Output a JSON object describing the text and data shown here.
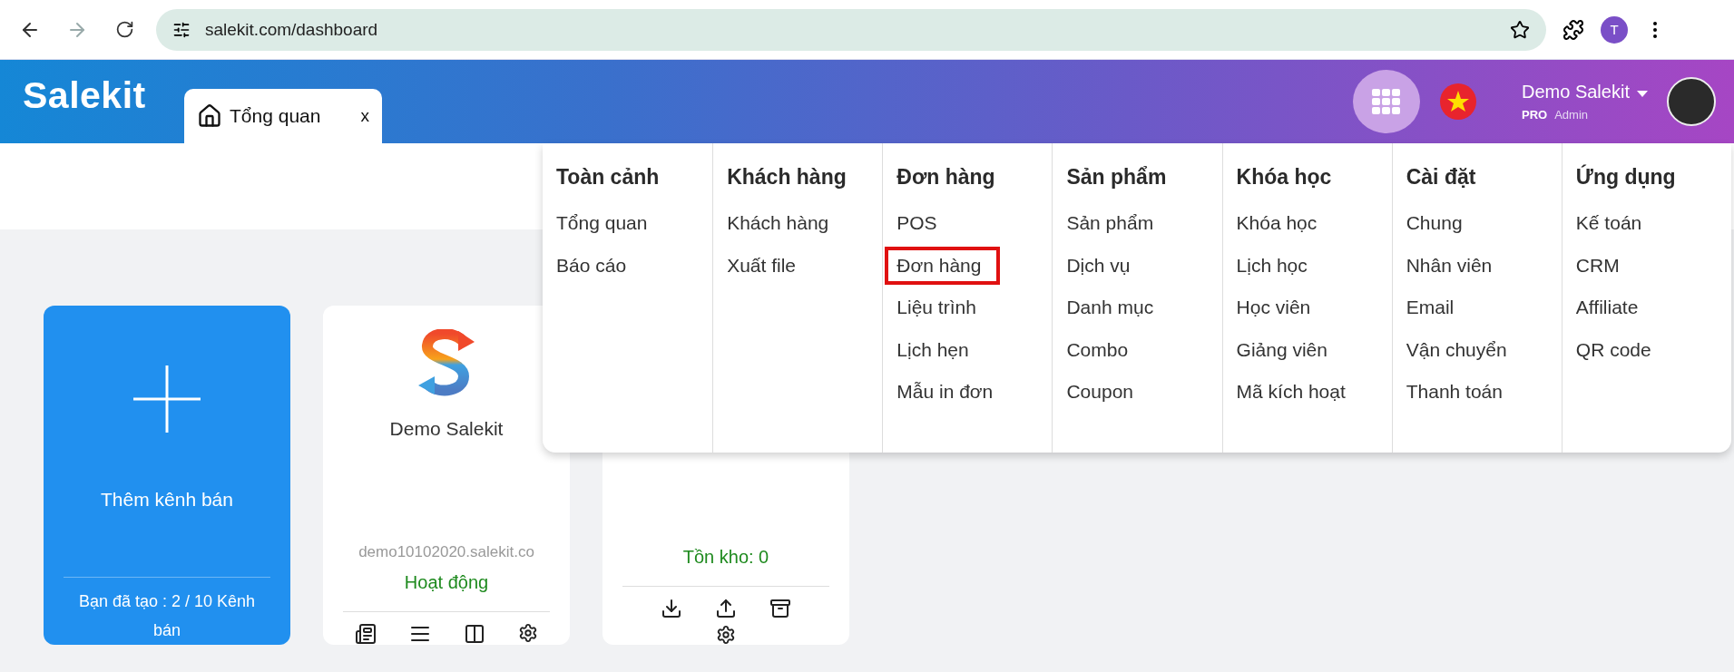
{
  "browser": {
    "url": "salekit.com/dashboard",
    "profile_initial": "T"
  },
  "header": {
    "logo": "Salekit",
    "tabs": [
      {
        "label": "Tổng quan",
        "close": "x",
        "selected": true
      }
    ],
    "user": {
      "name": "Demo Salekit",
      "plan": "PRO",
      "role": "Admin"
    }
  },
  "menu": {
    "columns": [
      {
        "title": "Toàn cảnh",
        "items": [
          {
            "label": "Tổng quan",
            "highlighted": false
          },
          {
            "label": "Báo cáo",
            "highlighted": false
          }
        ]
      },
      {
        "title": "Khách hàng",
        "items": [
          {
            "label": "Khách hàng",
            "highlighted": false
          },
          {
            "label": "Xuất file",
            "highlighted": false
          }
        ]
      },
      {
        "title": "Đơn hàng",
        "items": [
          {
            "label": "POS",
            "highlighted": false
          },
          {
            "label": "Đơn hàng",
            "highlighted": true
          },
          {
            "label": "Liệu trình",
            "highlighted": false
          },
          {
            "label": "Lịch hẹn",
            "highlighted": false
          },
          {
            "label": "Mẫu in đơn",
            "highlighted": false
          }
        ]
      },
      {
        "title": "Sản phẩm",
        "items": [
          {
            "label": "Sản phẩm",
            "highlighted": false
          },
          {
            "label": "Dịch vụ",
            "highlighted": false
          },
          {
            "label": "Danh mục",
            "highlighted": false
          },
          {
            "label": "Combo",
            "highlighted": false
          },
          {
            "label": "Coupon",
            "highlighted": false
          }
        ]
      },
      {
        "title": "Khóa học",
        "items": [
          {
            "label": "Khóa học",
            "highlighted": false
          },
          {
            "label": "Lịch học",
            "highlighted": false
          },
          {
            "label": "Học viên",
            "highlighted": false
          },
          {
            "label": "Giảng viên",
            "highlighted": false
          },
          {
            "label": "Mã kích hoạt",
            "highlighted": false
          }
        ]
      },
      {
        "title": "Cài đặt",
        "items": [
          {
            "label": "Chung",
            "highlighted": false
          },
          {
            "label": "Nhân viên",
            "highlighted": false
          },
          {
            "label": "Email",
            "highlighted": false
          },
          {
            "label": "Vận chuyển",
            "highlighted": false
          },
          {
            "label": "Thanh toán",
            "highlighted": false
          }
        ]
      },
      {
        "title": "Ứng dụng",
        "items": [
          {
            "label": "Kế toán",
            "highlighted": false
          },
          {
            "label": "CRM",
            "highlighted": false
          },
          {
            "label": "Affiliate",
            "highlighted": false
          },
          {
            "label": "QR code",
            "highlighted": false
          }
        ]
      }
    ]
  },
  "cards": [
    {
      "kind": "add",
      "label": "Thêm kênh bán",
      "footer": "Bạn đã tạo : 2 / 10 Kênh bán"
    },
    {
      "kind": "channel",
      "name": "Demo Salekit",
      "domain": "demo10102020.salekit.co",
      "status": "Hoạt động"
    },
    {
      "kind": "inventory",
      "stock": "Tồn kho: 0"
    }
  ]
}
